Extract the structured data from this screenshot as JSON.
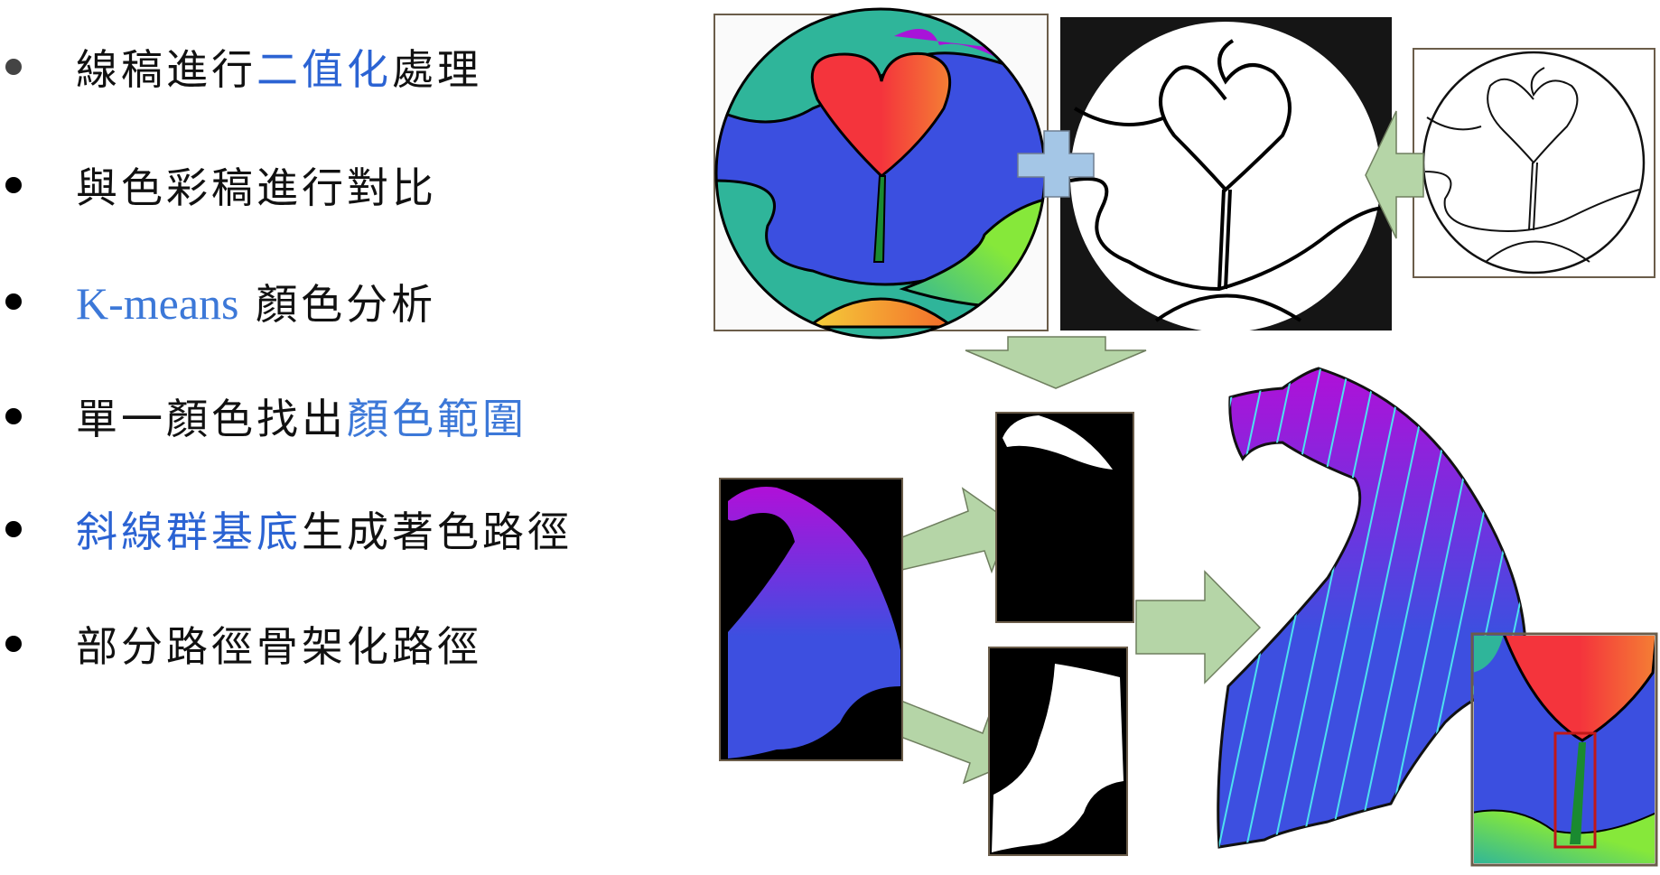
{
  "bullets": [
    {
      "segments": [
        {
          "text": "線稿進行",
          "highlight": false
        },
        {
          "text": "二值化",
          "highlight": true
        },
        {
          "text": "處理",
          "highlight": false
        }
      ]
    },
    {
      "segments": [
        {
          "text": "與色彩稿進行對比",
          "highlight": false
        }
      ]
    },
    {
      "segments": [
        {
          "text": "K-means",
          "highlight": true,
          "latin": true
        },
        {
          "text": " 顏色分析",
          "highlight": false
        }
      ]
    },
    {
      "segments": [
        {
          "text": "單一顏色找出",
          "highlight": false
        },
        {
          "text": "顏色範圍",
          "highlight": true
        }
      ]
    },
    {
      "segments": [
        {
          "text": "斜線群基底",
          "highlight": true
        },
        {
          "text": "生成著色路徑",
          "highlight": false
        }
      ]
    },
    {
      "segments": [
        {
          "text": "部分路徑骨架化路徑",
          "highlight": false
        }
      ]
    }
  ],
  "colors": {
    "highlight": "#2b63d3",
    "arrow_fill": "#b5d5a7",
    "plus_fill": "#a4c6e6",
    "fill_blue": "#3b4fe0",
    "fill_purple": "#a814d8"
  },
  "figures": {
    "color_sketch": "colored-circle-image",
    "binarized_line_art": "binarized-line-art-image",
    "line_art": "line-art-image",
    "region_crop": "region-crop-image",
    "mask_top": "mask-purple-image",
    "mask_bottom": "mask-blue-image",
    "hatched_paths": "hatched-paths-image",
    "skeleton_inset": "skeleton-inset-image"
  }
}
